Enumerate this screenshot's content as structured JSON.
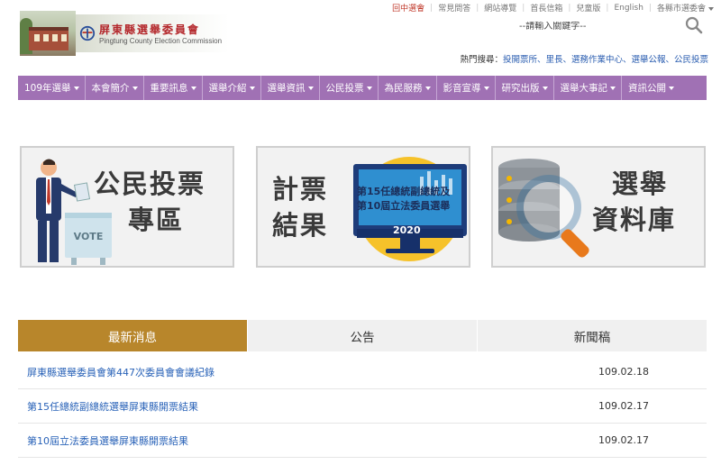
{
  "header": {
    "logo_title": "屏東縣選舉委員會",
    "logo_subtitle": "Pingtung County Election Commission",
    "top_links": [
      {
        "label": "回中選會",
        "active": true
      },
      {
        "label": "常見問答",
        "active": false
      },
      {
        "label": "網站導覽",
        "active": false
      },
      {
        "label": "首長信箱",
        "active": false
      },
      {
        "label": "兒童版",
        "active": false
      },
      {
        "label": "English",
        "active": false
      },
      {
        "label": "各縣市選委會",
        "active": false
      }
    ],
    "search_placeholder": "--請輸入關鍵字--",
    "hot_label": "熱門搜尋：",
    "hot_links": "投開票所、里長、選務作業中心、選舉公報、公民投票"
  },
  "nav": {
    "items": [
      "109年選舉",
      "本會簡介",
      "重要訊息",
      "選舉介紹",
      "選舉資訊",
      "公民投票",
      "為民服務",
      "影音宣導",
      "研究出版",
      "選舉大事記",
      "資訊公開"
    ]
  },
  "banners": [
    {
      "line1": "公民投票",
      "line2": "專區",
      "vote_label": "VOTE"
    },
    {
      "line1": "計票",
      "line2": "結果",
      "screen_line1": "第15任總統副總統及",
      "screen_line2": "第10屆立法委員選舉",
      "year": "2020"
    },
    {
      "line1": "選舉",
      "line2": "資料庫"
    }
  ],
  "tabs": [
    {
      "label": "最新消息",
      "active": true
    },
    {
      "label": "公告",
      "active": false
    },
    {
      "label": "新聞稿",
      "active": false
    }
  ],
  "news": [
    {
      "title": "屏東縣選舉委員會第447次委員會會議紀錄",
      "date": "109.02.18"
    },
    {
      "title": "第15任總統副總統選舉屏東縣開票結果",
      "date": "109.02.17"
    },
    {
      "title": "第10屆立法委員選舉屏東縣開票結果",
      "date": "109.02.17"
    }
  ],
  "colors": {
    "nav_bg": "#a071b4",
    "tab_active": "#b8862b",
    "link": "#2a63b8",
    "active_top_link": "#c0392b"
  }
}
